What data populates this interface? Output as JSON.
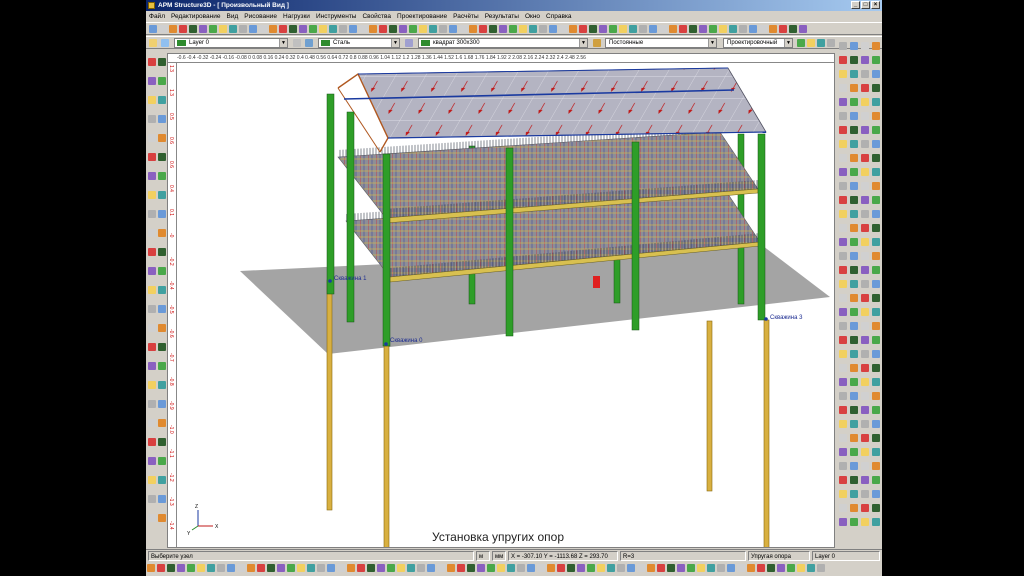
{
  "window": {
    "title": "APM Structure3D - [ Произвольный Вид ]"
  },
  "menu": [
    "Файл",
    "Редактирование",
    "Вид",
    "Рисование",
    "Нагрузки",
    "Инструменты",
    "Свойства",
    "Проектирование",
    "Расчёты",
    "Результаты",
    "Окно",
    "Справка"
  ],
  "props": {
    "layer": "Layer 0",
    "material": "Сталь",
    "section": "квадрат 300x300",
    "load_case": "Постоянные",
    "mode": "Проектировочный"
  },
  "ruler": {
    "h_marks": "-0.6  -0.4  -0.32  -0.24  -0.16  -0.08  0  0.08  0.16  0.24  0.32  0.4  0.48  0.56  0.64  0.72  0.8  0.88  0.96  1.04  1.12  1.2  1.28  1.36  1.44  1.52  1.6  1.68  1.76  1.84  1.92  2  2.08  2.16  2.24  2.32  2.4  2.48  2.56",
    "v_marks": [
      "1.3",
      "1.3",
      "0.5",
      "0.6",
      "0.6",
      "0.4",
      "0.1",
      "-0",
      "-0.2",
      "-0.4",
      "-0.5",
      "-0.6",
      "-0.7",
      "-0.8",
      "-0.9",
      "-1.0",
      "-1.1",
      "-1.2",
      "-1.3",
      "-1.4"
    ]
  },
  "scene": {
    "labels": {
      "pile0": "Скважина 0",
      "pile1": "Скважина 1",
      "pile3": "Скважина 3"
    },
    "axes": {
      "x": "X",
      "y": "Y",
      "z": "Z"
    }
  },
  "caption": "Установка упругих опор",
  "status": {
    "hint": "Выберите узел",
    "unit": "м",
    "length_unit": "мм",
    "coords": "X = -307.10  Y = -1113.68  Z = 293.70",
    "radius": "R=3",
    "object": "Упругая опора",
    "layer": "Layer 0"
  },
  "colors": {
    "column": "#2e9e28",
    "pile": "#d8b040",
    "ground": "#9a9a9a",
    "roof": "#b8b8c4",
    "selected": "#a020e0"
  }
}
